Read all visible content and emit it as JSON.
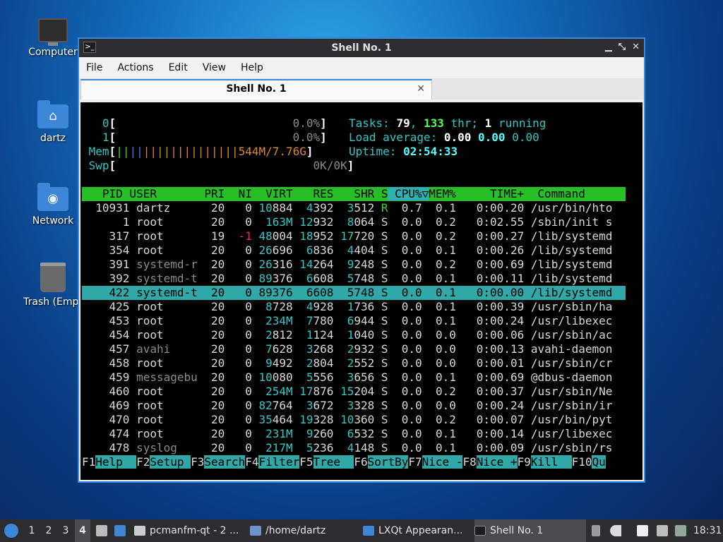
{
  "desktop_icons": [
    {
      "label": "Computer"
    },
    {
      "label": "dartz"
    },
    {
      "label": "Network"
    },
    {
      "label": "Trash (Empt"
    }
  ],
  "window": {
    "title": "Shell No. 1",
    "menu": [
      "File",
      "Actions",
      "Edit",
      "View",
      "Help"
    ],
    "tab": "Shell No. 1"
  },
  "htop": {
    "cpu0": {
      "label": "0",
      "value": "0.0%"
    },
    "cpu1": {
      "label": "1",
      "value": "0.0%"
    },
    "mem": {
      "label": "Mem",
      "bars": "||||||||||||||||||",
      "value": "544M/7.76G"
    },
    "swp": {
      "label": "Swp",
      "value": "0K/0K"
    },
    "tasks_label": "Tasks: ",
    "tasks": "79",
    "thr": "133",
    "thr_label": " thr; ",
    "running": "1",
    "running_label": " running",
    "load_label": "Load average: ",
    "load1": "0.00",
    "load5": "0.00",
    "load15": "0.00",
    "uptime_label": "Uptime: ",
    "uptime": "02:54:33",
    "columns": [
      "PID",
      "USER",
      "PRI",
      "NI",
      "VIRT",
      "RES",
      "SHR",
      "S",
      "CPU%▽",
      "MEM%",
      "TIME+",
      "Command"
    ],
    "processes": [
      {
        "pid": "10931",
        "user": "dartz",
        "pri": "20",
        "ni": "0",
        "virt": "10884",
        "res": "4392",
        "shr": "3512",
        "s": "R",
        "cpu": "0.7",
        "mem": "0.1",
        "time": "0:00.20",
        "cmd": "/usr/bin/hto"
      },
      {
        "pid": "1",
        "user": "root",
        "pri": "20",
        "ni": "0",
        "virt": "163M",
        "res": "12932",
        "shr": "8064",
        "s": "S",
        "cpu": "0.0",
        "mem": "0.2",
        "time": "0:02.55",
        "cmd": "/sbin/init s"
      },
      {
        "pid": "317",
        "user": "root",
        "pri": "19",
        "ni": "-1",
        "virt": "48004",
        "res": "18952",
        "shr": "17720",
        "s": "S",
        "cpu": "0.0",
        "mem": "0.2",
        "time": "0:00.27",
        "cmd": "/lib/systemd"
      },
      {
        "pid": "354",
        "user": "root",
        "pri": "20",
        "ni": "0",
        "virt": "26696",
        "res": "6836",
        "shr": "4404",
        "s": "S",
        "cpu": "0.0",
        "mem": "0.1",
        "time": "0:00.26",
        "cmd": "/lib/systemd"
      },
      {
        "pid": "391",
        "user": "systemd-r",
        "pri": "20",
        "ni": "0",
        "virt": "26316",
        "res": "14264",
        "shr": "9248",
        "s": "S",
        "cpu": "0.0",
        "mem": "0.2",
        "time": "0:00.69",
        "cmd": "/lib/systemd"
      },
      {
        "pid": "392",
        "user": "systemd-t",
        "pri": "20",
        "ni": "0",
        "virt": "89376",
        "res": "6608",
        "shr": "5748",
        "s": "S",
        "cpu": "0.0",
        "mem": "0.1",
        "time": "0:00.11",
        "cmd": "/lib/systemd"
      },
      {
        "pid": "422",
        "user": "systemd-t",
        "pri": "20",
        "ni": "0",
        "virt": "89376",
        "res": "6608",
        "shr": "5748",
        "s": "S",
        "cpu": "0.0",
        "mem": "0.1",
        "time": "0:00.00",
        "cmd": "/lib/systemd",
        "selected": true
      },
      {
        "pid": "425",
        "user": "root",
        "pri": "20",
        "ni": "0",
        "virt": "8728",
        "res": "4928",
        "shr": "1736",
        "s": "S",
        "cpu": "0.0",
        "mem": "0.1",
        "time": "0:00.39",
        "cmd": "/usr/sbin/ha"
      },
      {
        "pid": "453",
        "user": "root",
        "pri": "20",
        "ni": "0",
        "virt": "234M",
        "res": "7780",
        "shr": "6944",
        "s": "S",
        "cpu": "0.0",
        "mem": "0.1",
        "time": "0:00.24",
        "cmd": "/usr/libexec"
      },
      {
        "pid": "454",
        "user": "root",
        "pri": "20",
        "ni": "0",
        "virt": "2812",
        "res": "1124",
        "shr": "1040",
        "s": "S",
        "cpu": "0.0",
        "mem": "0.0",
        "time": "0:00.06",
        "cmd": "/usr/sbin/ac"
      },
      {
        "pid": "457",
        "user": "avahi",
        "pri": "20",
        "ni": "0",
        "virt": "7628",
        "res": "3268",
        "shr": "2932",
        "s": "S",
        "cpu": "0.0",
        "mem": "0.0",
        "time": "0:00.13",
        "cmd": "avahi-daemon"
      },
      {
        "pid": "458",
        "user": "root",
        "pri": "20",
        "ni": "0",
        "virt": "9492",
        "res": "2804",
        "shr": "2552",
        "s": "S",
        "cpu": "0.0",
        "mem": "0.0",
        "time": "0:00.01",
        "cmd": "/usr/sbin/cr"
      },
      {
        "pid": "459",
        "user": "messagebu",
        "pri": "20",
        "ni": "0",
        "virt": "10080",
        "res": "5556",
        "shr": "3656",
        "s": "S",
        "cpu": "0.0",
        "mem": "0.1",
        "time": "0:00.69",
        "cmd": "@dbus-daemon"
      },
      {
        "pid": "460",
        "user": "root",
        "pri": "20",
        "ni": "0",
        "virt": "254M",
        "res": "17876",
        "shr": "15204",
        "s": "S",
        "cpu": "0.0",
        "mem": "0.2",
        "time": "0:00.37",
        "cmd": "/usr/sbin/Ne"
      },
      {
        "pid": "469",
        "user": "root",
        "pri": "20",
        "ni": "0",
        "virt": "82764",
        "res": "3672",
        "shr": "3328",
        "s": "S",
        "cpu": "0.0",
        "mem": "0.0",
        "time": "0:00.24",
        "cmd": "/usr/sbin/ir"
      },
      {
        "pid": "470",
        "user": "root",
        "pri": "20",
        "ni": "0",
        "virt": "35464",
        "res": "19328",
        "shr": "10360",
        "s": "S",
        "cpu": "0.0",
        "mem": "0.2",
        "time": "0:00.07",
        "cmd": "/usr/bin/pyt"
      },
      {
        "pid": "474",
        "user": "root",
        "pri": "20",
        "ni": "0",
        "virt": "231M",
        "res": "9260",
        "shr": "6532",
        "s": "S",
        "cpu": "0.0",
        "mem": "0.1",
        "time": "0:00.14",
        "cmd": "/usr/libexec"
      },
      {
        "pid": "478",
        "user": "syslog",
        "pri": "20",
        "ni": "0",
        "virt": "217M",
        "res": "5236",
        "shr": "4148",
        "s": "S",
        "cpu": "0.0",
        "mem": "0.1",
        "time": "0:00.09",
        "cmd": "/usr/sbin/rs"
      }
    ],
    "fkeys": [
      {
        "key": "F1",
        "label": "Help  "
      },
      {
        "key": "F2",
        "label": "Setup "
      },
      {
        "key": "F3",
        "label": "Search"
      },
      {
        "key": "F4",
        "label": "Filter"
      },
      {
        "key": "F5",
        "label": "Tree  "
      },
      {
        "key": "F6",
        "label": "SortBy"
      },
      {
        "key": "F7",
        "label": "Nice -"
      },
      {
        "key": "F8",
        "label": "Nice +"
      },
      {
        "key": "F9",
        "label": "Kill  "
      },
      {
        "key": "F10",
        "label": "Qu"
      }
    ]
  },
  "taskbar": {
    "desktops": [
      "1",
      "2",
      "3",
      "4"
    ],
    "active_desktop": "4",
    "windows": [
      {
        "label": "pcmanfm-qt - 2 ..."
      },
      {
        "label": "/home/dartz"
      },
      {
        "label": "LXQt Appearan..."
      },
      {
        "label": "Shell No. 1"
      }
    ],
    "clock": "18:31"
  }
}
